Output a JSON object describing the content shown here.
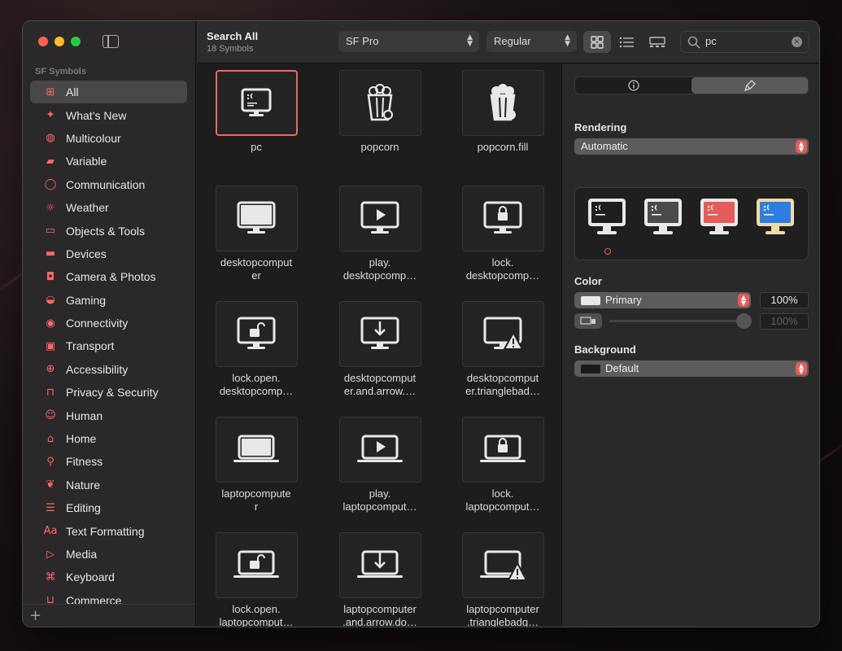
{
  "app": {
    "sidebar_section": "SF Symbols"
  },
  "sidebar": {
    "items": [
      {
        "label": "All",
        "icon": "grid-icon",
        "glyph": "⊞",
        "selected": true
      },
      {
        "label": "What’s New",
        "icon": "sparkle-icon",
        "glyph": "✦"
      },
      {
        "label": "Multicolour",
        "icon": "palette-icon",
        "glyph": "◍"
      },
      {
        "label": "Variable",
        "icon": "variable-icon",
        "glyph": "▰"
      },
      {
        "label": "Communication",
        "icon": "bubble-icon",
        "glyph": "◯"
      },
      {
        "label": "Weather",
        "icon": "sun-haze-icon",
        "glyph": "☼"
      },
      {
        "label": "Objects & Tools",
        "icon": "folder-icon",
        "glyph": "▭"
      },
      {
        "label": "Devices",
        "icon": "display-icon",
        "glyph": "▬"
      },
      {
        "label": "Camera & Photos",
        "icon": "camera-icon",
        "glyph": "◘"
      },
      {
        "label": "Gaming",
        "icon": "gamecontroller-icon",
        "glyph": "◒"
      },
      {
        "label": "Connectivity",
        "icon": "antenna-icon",
        "glyph": "◉"
      },
      {
        "label": "Transport",
        "icon": "car-icon",
        "glyph": "▣"
      },
      {
        "label": "Accessibility",
        "icon": "accessibility-icon",
        "glyph": "⊕"
      },
      {
        "label": "Privacy & Security",
        "icon": "lock-icon",
        "glyph": "⊓"
      },
      {
        "label": "Human",
        "icon": "person-icon",
        "glyph": "☺"
      },
      {
        "label": "Home",
        "icon": "house-icon",
        "glyph": "⌂"
      },
      {
        "label": "Fitness",
        "icon": "figure-run-icon",
        "glyph": "⚲"
      },
      {
        "label": "Nature",
        "icon": "leaf-icon",
        "glyph": "❦"
      },
      {
        "label": "Editing",
        "icon": "sliders-icon",
        "glyph": "☰"
      },
      {
        "label": "Text Formatting",
        "icon": "textformat-icon",
        "glyph": "Aa"
      },
      {
        "label": "Media",
        "icon": "playpause-icon",
        "glyph": "▷"
      },
      {
        "label": "Keyboard",
        "icon": "command-icon",
        "glyph": "⌘"
      },
      {
        "label": "Commerce",
        "icon": "cart-icon",
        "glyph": "⊔"
      }
    ]
  },
  "toolbar": {
    "title": "Search All",
    "subtitle": "18 Symbols",
    "font_popup": "SF Pro",
    "weight_popup": "Regular",
    "search_value": "pc"
  },
  "symbols": [
    {
      "label": "pc",
      "kind": "pc",
      "selected": true
    },
    {
      "label": "popcorn",
      "kind": "popcorn"
    },
    {
      "label": "popcorn.fill",
      "kind": "popcorn-fill"
    },
    {
      "label": "desktopcomput\ner",
      "kind": "desktop"
    },
    {
      "label": "play.\ndesktopcomp…",
      "kind": "desktop-play"
    },
    {
      "label": "lock.\ndesktopcomp…",
      "kind": "desktop-lock"
    },
    {
      "label": "lock.open.\ndesktopcomp…",
      "kind": "desktop-unlock"
    },
    {
      "label": "desktopcomput\ner.and.arrow.…",
      "kind": "desktop-arrow"
    },
    {
      "label": "desktopcomput\ner.trianglebad…",
      "kind": "desktop-warn"
    },
    {
      "label": "laptopcompute\nr",
      "kind": "laptop"
    },
    {
      "label": "play.\nlaptopcomput…",
      "kind": "laptop-play"
    },
    {
      "label": "lock.\nlaptopcomput…",
      "kind": "laptop-lock"
    },
    {
      "label": "lock.open.\nlaptopcomput…",
      "kind": "laptop-unlock"
    },
    {
      "label": "laptopcomputer\n.and.arrow.do…",
      "kind": "laptop-arrow"
    },
    {
      "label": "laptopcomputer\n.trianglebadg…",
      "kind": "laptop-warn"
    }
  ],
  "inspector": {
    "rendering_label": "Rendering",
    "rendering_value": "Automatic",
    "color_label": "Color",
    "color_value": "Primary",
    "color_opacity": "100%",
    "secondary_opacity": "100%",
    "background_label": "Background",
    "background_value": "Default",
    "render_modes": [
      {
        "name": "monochrome",
        "screen": "#1e1e1e",
        "body": "#e8e8e8"
      },
      {
        "name": "hierarchical",
        "screen": "#4a4a4a",
        "body": "#e8e8e8"
      },
      {
        "name": "palette",
        "screen": "#e35c5a",
        "body": "#e8e8e8"
      },
      {
        "name": "multicolor",
        "screen": "#2f7de1",
        "body": "#f2d9a8"
      }
    ],
    "accent": "#e25d5a"
  }
}
